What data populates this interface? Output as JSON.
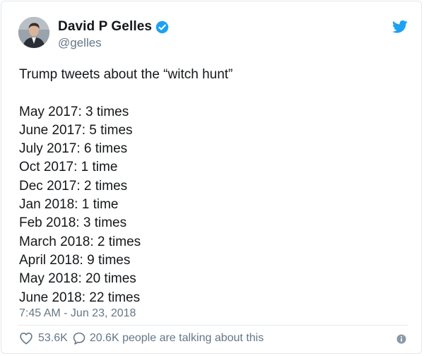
{
  "author": {
    "display_name": "David P Gelles",
    "handle": "@gelles"
  },
  "icons": {
    "avatar": "avatar-photo",
    "verified": "verified-badge-icon",
    "brand": "twitter-bird-icon",
    "like": "heart-icon",
    "reply": "speech-bubble-icon",
    "info": "info-icon"
  },
  "colors": {
    "brand": "#1da1f2",
    "text": "#14171a",
    "muted": "#657786"
  },
  "tweet": {
    "intro": "Trump tweets about the “witch hunt”",
    "lines": [
      "May 2017: 3 times",
      "June 2017: 5 times",
      "July 2017: 6 times",
      "Oct 2017: 1 time",
      "Dec 2017: 2 times",
      "Jan 2018: 1 time",
      "Feb 2018: 3 times",
      "March 2018: 2 times",
      "April 2018: 9 times",
      "May 2018: 20 times",
      "June 2018: 22 times"
    ],
    "timestamp": "7:45 AM - Jun 23, 2018"
  },
  "stats": {
    "likes": "53.6K",
    "talking": "20.6K people are talking about this"
  }
}
